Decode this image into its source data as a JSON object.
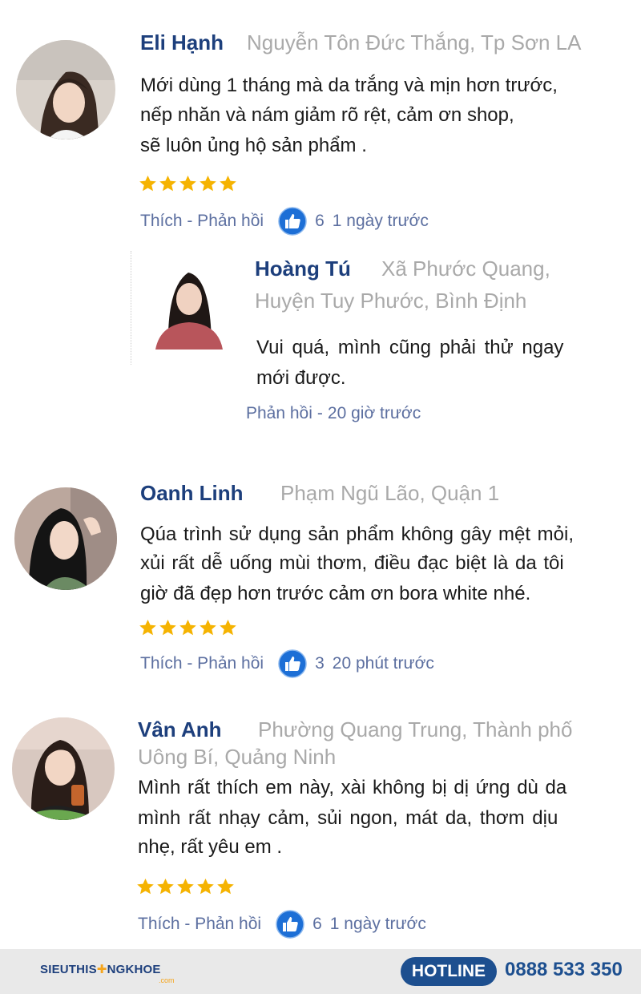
{
  "comments": [
    {
      "name": "Eli Hạnh",
      "location": "Nguyễn Tôn Đức Thắng, Tp Sơn LA",
      "lines": [
        "Mới dùng 1 tháng mà da trắng và mịn hơn trước,",
        "nếp nhăn và nám giảm rõ rệt, cảm ơn shop,",
        "sẽ luôn ủng hộ sản phẩm ."
      ],
      "rating": 5,
      "actions": "Thích - Phản hồi",
      "likes": "6",
      "time": "1 ngày trước",
      "reply": {
        "name": "Hoàng Tú",
        "location_lines": [
          "Xã Phước Quang,",
          "Huyện Tuy Phước, Bình Định"
        ],
        "lines": [
          "Vui quá, mình cũng phải thử ngay",
          "mới được."
        ],
        "actions": "Phản hồi",
        "time": "20 giờ trước"
      }
    },
    {
      "name": "Oanh Linh",
      "location": "Phạm Ngũ Lão, Quận 1",
      "lines": [
        "Qúa trình sử dụng sản phẩm không gây mệt mỏi,",
        "xủi rất dễ uống mùi thơm, điều đạc biệt là da tôi",
        "giờ đã đẹp hơn trước  cảm ơn bora white nhé."
      ],
      "rating": 5,
      "actions": "Thích - Phản hồi",
      "likes": "3",
      "time": "20 phút trước"
    },
    {
      "name": "Vân Anh",
      "location_lines": [
        "Phường Quang Trung, Thành phố",
        "Uông Bí, Quảng Ninh"
      ],
      "lines": [
        "Mình rất thích em này, xài không bị dị ứng dù da",
        "mình rất nhạy cảm, sủi ngon, mát da, thơm dịu",
        "nhẹ, rất yêu em ."
      ],
      "rating": 5,
      "actions": "Thích - Phản hồi",
      "likes": "6",
      "time": "1 ngày trước"
    }
  ],
  "footer": {
    "brand_left": "SIEUTHIS",
    "brand_right": "NGKHOE",
    "brand_sub": ".com",
    "hotline_label": "HOTLINE",
    "hotline_number": "0888 533 350"
  },
  "colors": {
    "name": "#1d3f7c",
    "location": "#a9a9a9",
    "star": "#f5b301",
    "like": "#1d6fd6",
    "hotline": "#1d4f8f"
  }
}
